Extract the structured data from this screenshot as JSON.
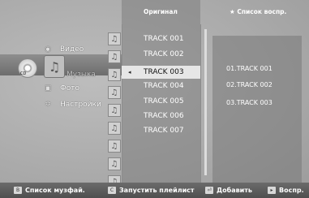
{
  "menu": {
    "items": [
      {
        "label": "Видео",
        "icon": "video-icon"
      },
      {
        "label": "Музыка",
        "icon": "music-icon"
      },
      {
        "label": "Фото",
        "icon": "photo-icon"
      },
      {
        "label": "Настройки",
        "icon": "settings-icon"
      }
    ],
    "disc_label": "CD"
  },
  "columns": {
    "original_header": "Оригинал",
    "playlist_header": "Список воспр.",
    "playlist_star": "★"
  },
  "tracks": [
    "TRACK 001",
    "TRACK 002",
    "TRACK 003",
    "TRACK 004",
    "TRACK 005",
    "TRACK 006",
    "TRACK 007"
  ],
  "selected_track_arrow": "◂",
  "playlist": [
    "01.TRACK 001",
    "02.TRACK 002",
    "03.TRACK 003"
  ],
  "bottom": {
    "b_key": "B",
    "b_label": "Список музфай.",
    "c_key": "C",
    "c_label": "Запустить плейлист",
    "add_key": "⏎",
    "add_label": "Добавить",
    "play_key": "▸",
    "play_label": "Воспр."
  }
}
